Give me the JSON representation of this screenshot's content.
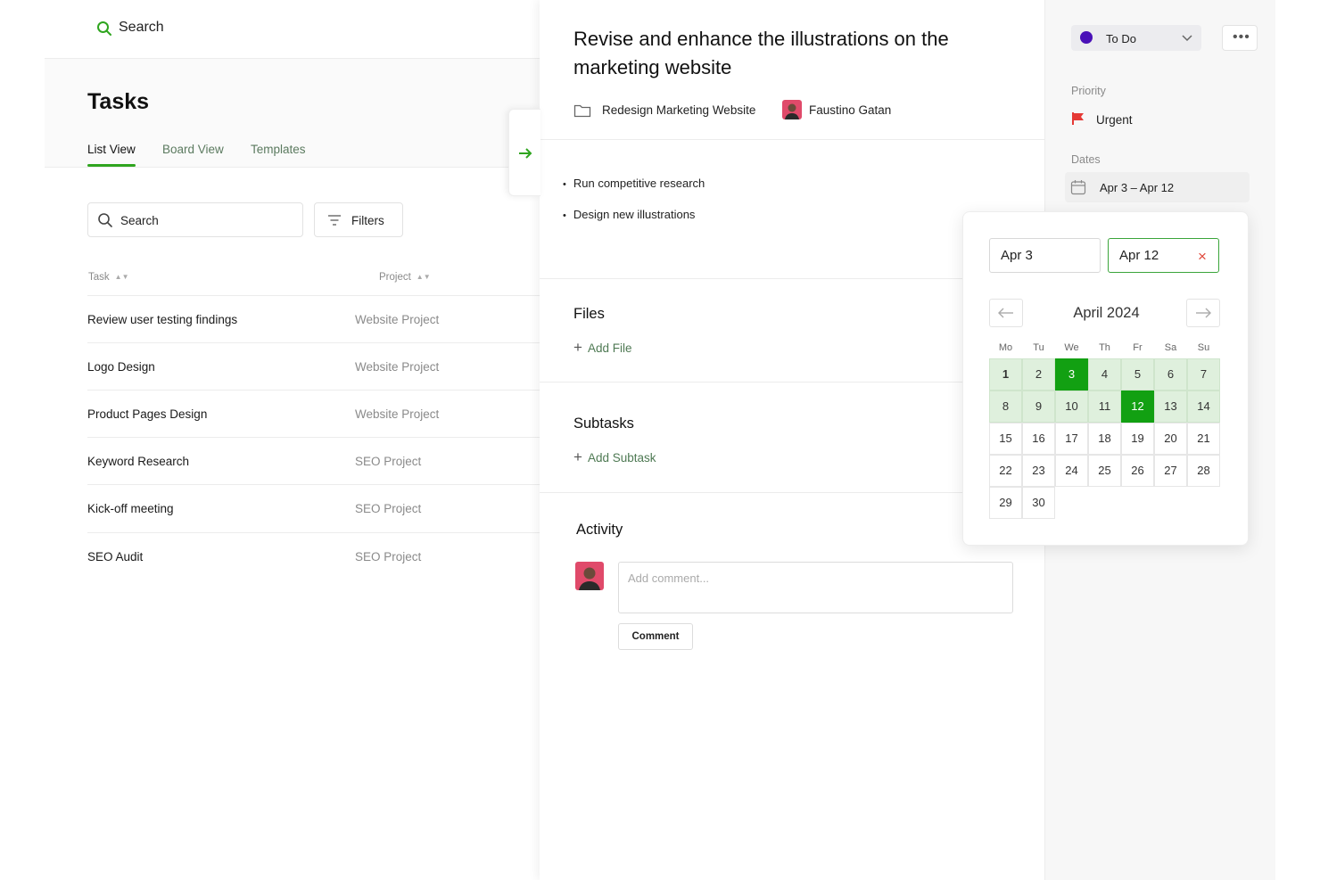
{
  "left": {
    "top_search_label": "Search",
    "title": "Tasks",
    "tabs": [
      {
        "label": "List View",
        "active": true
      },
      {
        "label": "Board View",
        "active": false
      },
      {
        "label": "Templates",
        "active": false
      }
    ],
    "search_placeholder": "Search",
    "filters_label": "Filters",
    "columns": [
      "Task",
      "Project"
    ],
    "rows": [
      {
        "task": "Review user testing findings",
        "project": "Website Project"
      },
      {
        "task": "Logo Design",
        "project": "Website Project"
      },
      {
        "task": "Product Pages Design",
        "project": "Website Project"
      },
      {
        "task": "Keyword Research",
        "project": "SEO Project"
      },
      {
        "task": "Kick-off meeting",
        "project": "SEO Project"
      },
      {
        "task": "SEO Audit",
        "project": "SEO Project"
      }
    ]
  },
  "detail": {
    "title": "Revise and enhance the illustrations on the marketing website",
    "project": "Redesign Marketing Website",
    "assignee": "Faustino Gatan",
    "bullets": [
      "Run competitive research",
      "Design new illustrations"
    ],
    "files_title": "Files",
    "add_file": "Add File",
    "subtasks_title": "Subtasks",
    "add_subtask": "Add Subtask",
    "activity_title": "Activity",
    "comment_placeholder": "Add comment...",
    "comment_button": "Comment"
  },
  "side": {
    "status": "To Do",
    "status_color": "#4a11b8",
    "more_label": "•••",
    "priority_label": "Priority",
    "priority_value": "Urgent",
    "priority_color": "#e53935",
    "dates_label": "Dates",
    "dates_value": "Apr 3 – Apr 12"
  },
  "picker": {
    "start": "Apr 3",
    "end": "Apr 12",
    "clear_icon": "×",
    "month": "April 2024",
    "weekdays": [
      "Mo",
      "Tu",
      "We",
      "Th",
      "Fr",
      "Sa",
      "Su"
    ],
    "days": [
      1,
      2,
      3,
      4,
      5,
      6,
      7,
      8,
      9,
      10,
      11,
      12,
      13,
      14,
      15,
      16,
      17,
      18,
      19,
      20,
      21,
      22,
      23,
      24,
      25,
      26,
      27,
      28,
      29,
      30
    ],
    "today": 1,
    "range_start": 3,
    "range_end": 12,
    "highlight_from": 1,
    "highlight_to": 14,
    "accent": "#12a012"
  }
}
